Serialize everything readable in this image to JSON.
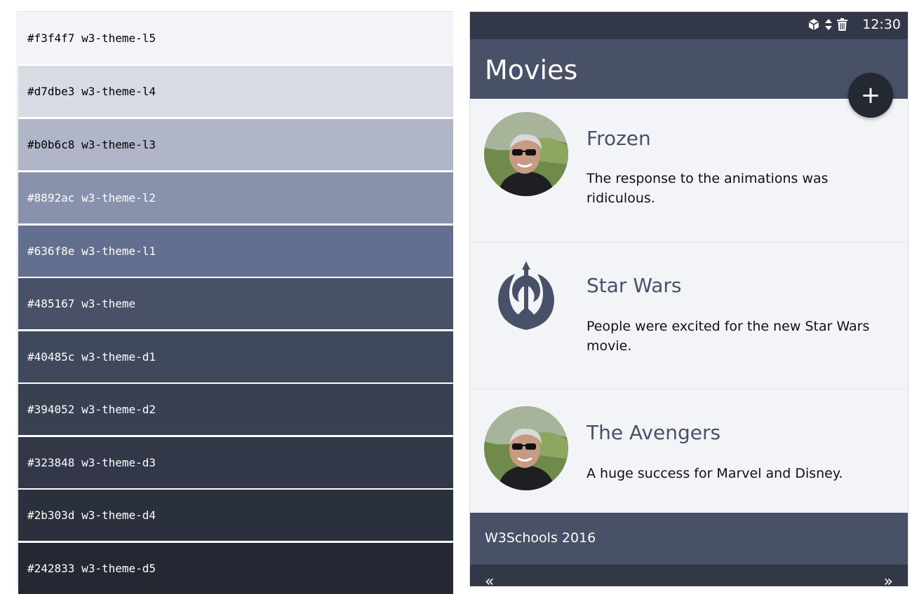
{
  "palette": {
    "swatches": [
      {
        "hex": "#f3f4f7",
        "label": "#f3f4f7 w3-theme-l5",
        "text_color": "#000000"
      },
      {
        "hex": "#d7dbe3",
        "label": "#d7dbe3 w3-theme-l4",
        "text_color": "#000000"
      },
      {
        "hex": "#b0b6c8",
        "label": "#b0b6c8 w3-theme-l3",
        "text_color": "#000000"
      },
      {
        "hex": "#8892ac",
        "label": "#8892ac w3-theme-l2",
        "text_color": "#ffffff"
      },
      {
        "hex": "#636f8e",
        "label": "#636f8e w3-theme-l1",
        "text_color": "#ffffff"
      },
      {
        "hex": "#485167",
        "label": "#485167 w3-theme",
        "text_color": "#ffffff"
      },
      {
        "hex": "#40485c",
        "label": "#40485c w3-theme-d1",
        "text_color": "#ffffff"
      },
      {
        "hex": "#394052",
        "label": "#394052 w3-theme-d2",
        "text_color": "#ffffff"
      },
      {
        "hex": "#323848",
        "label": "#323848 w3-theme-d3",
        "text_color": "#ffffff"
      },
      {
        "hex": "#2b303d",
        "label": "#2b303d w3-theme-d4",
        "text_color": "#ffffff"
      },
      {
        "hex": "#242833",
        "label": "#242833 w3-theme-d5",
        "text_color": "#ffffff"
      }
    ]
  },
  "phone": {
    "status": {
      "time": "12:30",
      "icons": [
        "cube-icon",
        "sort-icon",
        "trash-icon"
      ]
    },
    "appbar": {
      "title": "Movies"
    },
    "fab": {
      "label": "+"
    },
    "items": [
      {
        "title": "Frozen",
        "text": "The response to the animations was ridiculous.",
        "avatar": "person-avatar"
      },
      {
        "title": "Star Wars",
        "text": "People were excited for the new Star Wars movie.",
        "avatar": "rebel-alliance-logo"
      },
      {
        "title": "The Avengers",
        "text": "A huge success for Marvel and Disney.",
        "avatar": "person-avatar"
      }
    ],
    "footer": {
      "text": "W3Schools 2016"
    },
    "bottom_nav": {
      "prev": "«",
      "next": "»"
    }
  },
  "colors": {
    "theme": "#485167",
    "theme_d3": "#323848",
    "theme_d5": "#242833",
    "theme_l5": "#f3f4f7"
  }
}
